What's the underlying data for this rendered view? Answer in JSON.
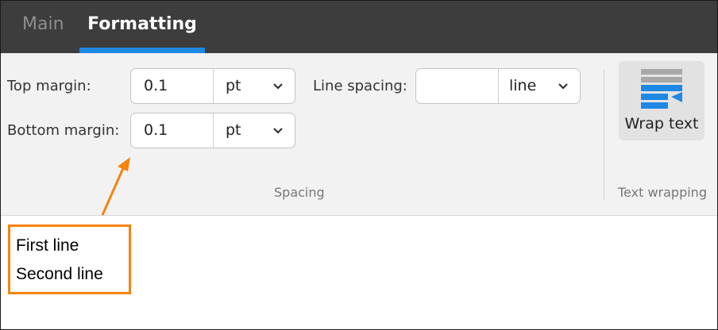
{
  "tabs": [
    {
      "label": "Main",
      "active": false
    },
    {
      "label": "Formatting",
      "active": true
    }
  ],
  "spacing": {
    "top_margin": {
      "label": "Top margin:",
      "value": "0.1",
      "unit": "pt"
    },
    "bottom_margin": {
      "label": "Bottom margin:",
      "value": "0.1",
      "unit": "pt"
    },
    "line_spacing": {
      "label": "Line spacing:",
      "value": "",
      "unit": "line"
    },
    "group_label": "Spacing"
  },
  "text_wrapping": {
    "button_label": "Wrap text",
    "group_label": "Text wrapping"
  },
  "document": {
    "lines": [
      "First line",
      "Second line"
    ]
  },
  "colors": {
    "tab_bar": "#3d3d3d",
    "accent": "#1e88e5",
    "annotation": "#f7830f",
    "ribbon": "#f2f2f2"
  },
  "icons": {
    "dropdown": "chevron-down-icon",
    "wrap": "wrap-text-icon",
    "annotation": "annotation-arrow"
  }
}
